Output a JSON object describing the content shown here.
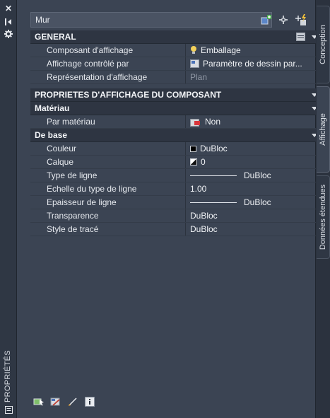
{
  "palette": {
    "panel_bg": "#3b4453",
    "section_bg": "#2e3542",
    "text": "#e6e9ee",
    "dim_text": "#8f97a4"
  },
  "titlebar": {
    "title": "PROPRIÉTÉS",
    "icons": [
      "close-icon",
      "autohide-icon",
      "settings-icon",
      "properties-icon"
    ]
  },
  "header": {
    "selected_type": "Mur",
    "icons": [
      "add-selected-icon",
      "select-objects-icon",
      "quick-select-icon"
    ]
  },
  "sections": {
    "general": {
      "title": "GENERAL",
      "rows": [
        {
          "label": "Composant d'affichage",
          "value": "Emballage",
          "icon": "bulb-icon"
        },
        {
          "label": "Affichage contrôlé par",
          "value": "Paramètre de dessin par...",
          "icon": "drawing-settings-icon"
        },
        {
          "label": "Représentation d'affichage",
          "value": "Plan"
        }
      ]
    },
    "component": {
      "title": "PROPRIETES D'AFFICHAGE DU COMPOSANT"
    },
    "material": {
      "title": "Matériau",
      "rows": [
        {
          "label": "Par matériau",
          "value": "Non",
          "icon": "material-icon"
        }
      ]
    },
    "base": {
      "title": "De base",
      "rows": [
        {
          "label": "Couleur",
          "value": "DuBloc",
          "icon": "color-swatch-icon",
          "color": "#000000"
        },
        {
          "label": "Calque",
          "value": "0",
          "icon": "layer-icon"
        },
        {
          "label": "Type de ligne",
          "value": "DuBloc",
          "icon": "linetype-sample"
        },
        {
          "label": "Echelle du type de ligne",
          "value": "1.00"
        },
        {
          "label": "Epaisseur de ligne",
          "value": "DuBloc",
          "icon": "lineweight-sample"
        },
        {
          "label": "Transparence",
          "value": "DuBloc"
        },
        {
          "label": "Style de tracé",
          "value": "DuBloc"
        }
      ]
    }
  },
  "footer_icons": [
    "select-object-icon",
    "select-display-icon",
    "edit-style-icon",
    "info-icon"
  ],
  "tabs": [
    {
      "label": "Conception",
      "active": false
    },
    {
      "label": "Affichage",
      "active": true
    },
    {
      "label": "Données étendues",
      "active": false
    }
  ]
}
